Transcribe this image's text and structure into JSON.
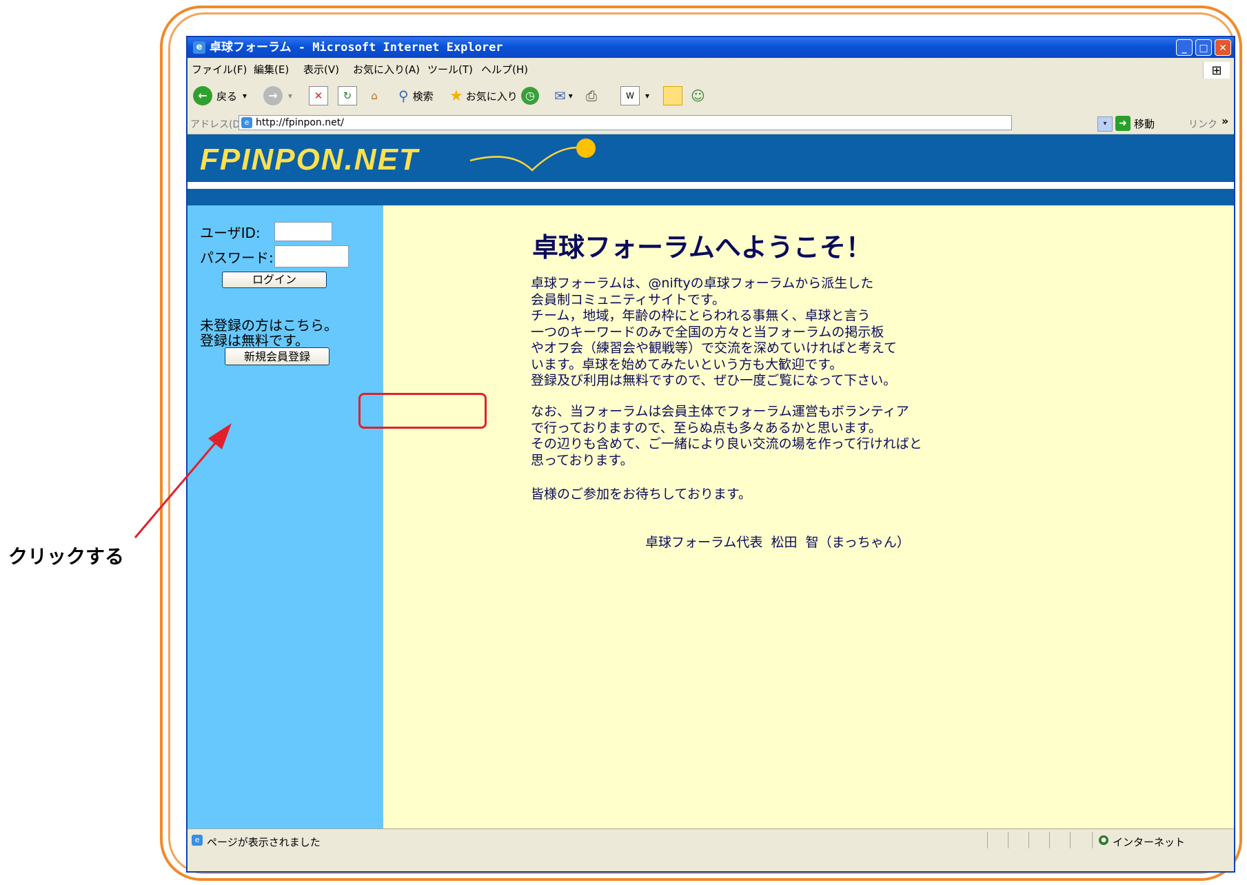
{
  "window": {
    "title": "卓球フォーラム - Microsoft Internet Explorer",
    "min_glyph": "_",
    "max_glyph": "□",
    "close_glyph": "✕"
  },
  "menubar": {
    "items": [
      "ファイル(F)",
      "編集(E)",
      "表示(V)",
      "お気に入り(A)",
      "ツール(T)",
      "ヘルプ(H)"
    ]
  },
  "toolbar": {
    "back_label": "戻る",
    "search_label": "検索",
    "favorites_label": "お気に入り",
    "dropdown_glyph": "▾"
  },
  "address": {
    "label": "アドレス(D)",
    "url": "http://fpinpon.net/",
    "go_label": "移動",
    "links_label": "リンク",
    "links_chevron": "»"
  },
  "site": {
    "logo": "FPINPON.NET"
  },
  "login": {
    "userid_label": "ユーザID:",
    "password_label": "パスワード:",
    "login_button": "ログイン",
    "unregistered_line1": "未登録の方はこちら。",
    "unregistered_line2": "登録は無料です。",
    "register_button": "新規会員登録"
  },
  "main": {
    "heading": "卓球フォーラムへようこそ！",
    "paragraph1": [
      "卓球フォーラムは、@niftyの卓球フォーラムから派生した",
      "会員制コミュニティサイトです。",
      "チーム，地域，年齢の枠にとらわれる事無く、卓球と言う",
      "一つのキーワードのみで全国の方々と当フォーラムの掲示板",
      "やオフ会（練習会や観戦等）で交流を深めていければと考えて",
      "います。卓球を始めてみたいという方も大歓迎です。",
      "登録及び利用は無料ですので、ぜひ一度ご覧になって下さい。"
    ],
    "paragraph2": [
      "なお、当フォーラムは会員主体でフォーラム運営もボランティア",
      "で行っておりますので、至らぬ点も多々あるかと思います。",
      "その辺りも含めて、ご一緒により良い交流の場を作って行ければと",
      "思っております。"
    ],
    "paragraph3": "皆様のご参加をお待ちしております。",
    "signature": "卓球フォーラム代表  松田  智（まっちゃん）"
  },
  "status": {
    "text": "ページが表示されました",
    "zone": "インターネット"
  },
  "annotation": {
    "callout": "クリックする",
    "color": "#e2202a"
  },
  "colors": {
    "frame": "#f08a2a",
    "banner": "#0b60a8",
    "sidebar": "#66c8fc",
    "content_bg": "#ffffcc",
    "logo": "#ffe14d"
  }
}
